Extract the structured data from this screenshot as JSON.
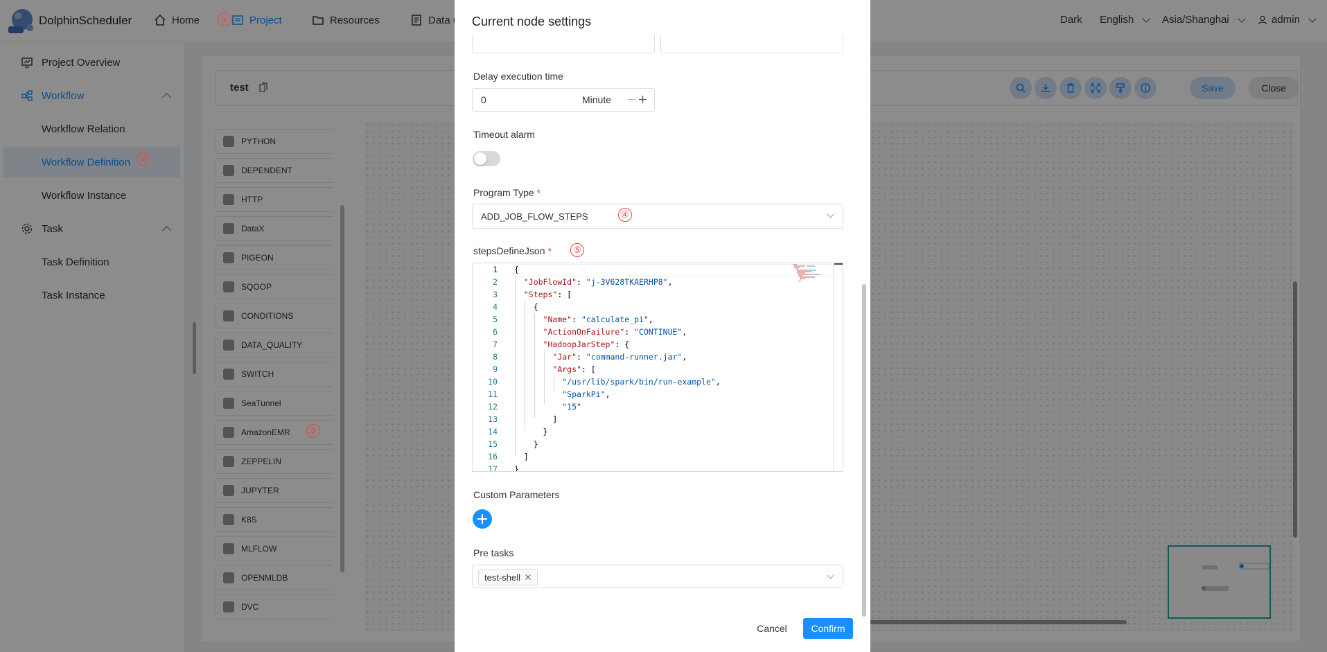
{
  "header": {
    "logo_text": "DolphinScheduler",
    "nav": [
      {
        "label": "Home",
        "icon": "home-icon"
      },
      {
        "label": "Project",
        "icon": "project-icon"
      },
      {
        "label": "Resources",
        "icon": "folder-icon"
      },
      {
        "label": "Data Q",
        "icon": "data-quality-icon"
      }
    ],
    "theme": "Dark",
    "language": "English",
    "timezone": "Asia/Shanghai",
    "user": "admin"
  },
  "sidebar": {
    "items": [
      {
        "label": "Project Overview"
      },
      {
        "label": "Workflow"
      },
      {
        "label": "Workflow Relation"
      },
      {
        "label": "Workflow Definition"
      },
      {
        "label": "Workflow Instance"
      },
      {
        "label": "Task"
      },
      {
        "label": "Task Definition"
      },
      {
        "label": "Task Instance"
      }
    ]
  },
  "toolbar": {
    "workflow_name": "test",
    "save_label": "Save",
    "close_label": "Close"
  },
  "palette": {
    "items": [
      "PYTHON",
      "DEPENDENT",
      "HTTP",
      "DataX",
      "PIGEON",
      "SQOOP",
      "CONDITIONS",
      "DATA_QUALITY",
      "SWITCH",
      "SeaTunnel",
      "AmazonEMR",
      "ZEPPELIN",
      "JUPYTER",
      "K8S",
      "MLFLOW",
      "OPENMLDB",
      "DVC"
    ]
  },
  "modal": {
    "title": "Current node settings",
    "delay_label": "Delay execution time",
    "delay_value": "0",
    "delay_unit": "Minute",
    "timeout_label": "Timeout alarm",
    "program_type_label": "Program Type",
    "program_type_value": "ADD_JOB_FLOW_STEPS",
    "steps_label": "stepsDefineJson",
    "custom_params_label": "Custom Parameters",
    "pre_tasks_label": "Pre tasks",
    "pre_task_tag": "test-shell",
    "cancel_label": "Cancel",
    "confirm_label": "Confirm"
  },
  "code_lines": [
    {
      "n": "1",
      "t": [
        [
          "p",
          "{"
        ]
      ]
    },
    {
      "n": "2",
      "t": [
        [
          "p",
          "  "
        ],
        [
          "k",
          "\"JobFlowId\""
        ],
        [
          "p",
          ": "
        ],
        [
          "s",
          "\"j-3V628TKAERHP8\""
        ],
        [
          "p",
          ","
        ]
      ]
    },
    {
      "n": "3",
      "t": [
        [
          "p",
          "  "
        ],
        [
          "k",
          "\"Steps\""
        ],
        [
          "p",
          ": ["
        ]
      ]
    },
    {
      "n": "4",
      "t": [
        [
          "p",
          "    {"
        ]
      ]
    },
    {
      "n": "5",
      "t": [
        [
          "p",
          "      "
        ],
        [
          "k",
          "\"Name\""
        ],
        [
          "p",
          ": "
        ],
        [
          "s",
          "\"calculate_pi\""
        ],
        [
          "p",
          ","
        ]
      ]
    },
    {
      "n": "6",
      "t": [
        [
          "p",
          "      "
        ],
        [
          "k",
          "\"ActionOnFailure\""
        ],
        [
          "p",
          ": "
        ],
        [
          "s",
          "\"CONTINUE\""
        ],
        [
          "p",
          ","
        ]
      ]
    },
    {
      "n": "7",
      "t": [
        [
          "p",
          "      "
        ],
        [
          "k",
          "\"HadoopJarStep\""
        ],
        [
          "p",
          ": {"
        ]
      ]
    },
    {
      "n": "8",
      "t": [
        [
          "p",
          "        "
        ],
        [
          "k",
          "\"Jar\""
        ],
        [
          "p",
          ": "
        ],
        [
          "s",
          "\"command-runner.jar\""
        ],
        [
          "p",
          ","
        ]
      ]
    },
    {
      "n": "9",
      "t": [
        [
          "p",
          "        "
        ],
        [
          "k",
          "\"Args\""
        ],
        [
          "p",
          ": ["
        ]
      ]
    },
    {
      "n": "10",
      "t": [
        [
          "p",
          "          "
        ],
        [
          "s",
          "\"/usr/lib/spark/bin/run-example\""
        ],
        [
          "p",
          ","
        ]
      ]
    },
    {
      "n": "11",
      "t": [
        [
          "p",
          "          "
        ],
        [
          "s",
          "\"SparkPi\""
        ],
        [
          "p",
          ","
        ]
      ]
    },
    {
      "n": "12",
      "t": [
        [
          "p",
          "          "
        ],
        [
          "s",
          "\"15\""
        ]
      ]
    },
    {
      "n": "13",
      "t": [
        [
          "p",
          "        ]"
        ]
      ]
    },
    {
      "n": "14",
      "t": [
        [
          "p",
          "      }"
        ]
      ]
    },
    {
      "n": "15",
      "t": [
        [
          "p",
          "    }"
        ]
      ]
    },
    {
      "n": "16",
      "t": [
        [
          "p",
          "  ]"
        ]
      ]
    },
    {
      "n": "17",
      "t": [
        [
          "p",
          "}"
        ]
      ]
    }
  ],
  "markers": [
    "①",
    "②",
    "③",
    "④",
    "⑤"
  ],
  "colors": {
    "accent": "#1890ff",
    "marker": "#e8463a",
    "json_key": "#a31515",
    "json_string": "#0451a5"
  }
}
